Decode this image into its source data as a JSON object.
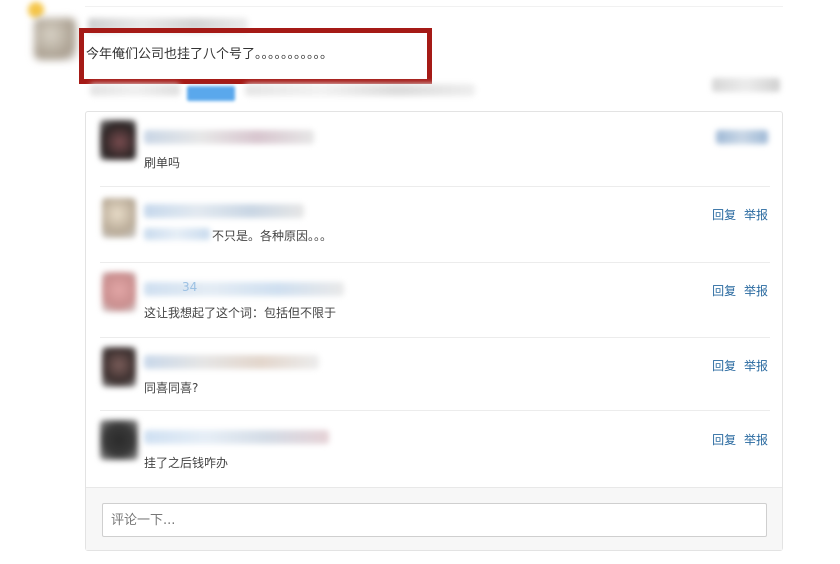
{
  "post": {
    "text": "今年俺们公司也挂了八个号了。。。。。。。。。。。"
  },
  "comments": [
    {
      "text": "刷单吗",
      "reply": "",
      "report": ""
    },
    {
      "text_prefix": "不只是。各种原因。。。",
      "reply": "回复",
      "report": "举报"
    },
    {
      "name_fragment": "34",
      "text": "这让我想起了这个词：包括但不限于",
      "reply": "回复",
      "report": "举报"
    },
    {
      "text": "同喜同喜?",
      "reply": "回复",
      "report": "举报"
    },
    {
      "text": "挂了之后钱咋办",
      "reply": "回复",
      "report": "举报"
    }
  ],
  "comment_input": {
    "placeholder": "评论一下..."
  },
  "colors": {
    "highlight_border": "#a51a16",
    "link": "#2a6aa0",
    "button": "#5aa8ec"
  }
}
